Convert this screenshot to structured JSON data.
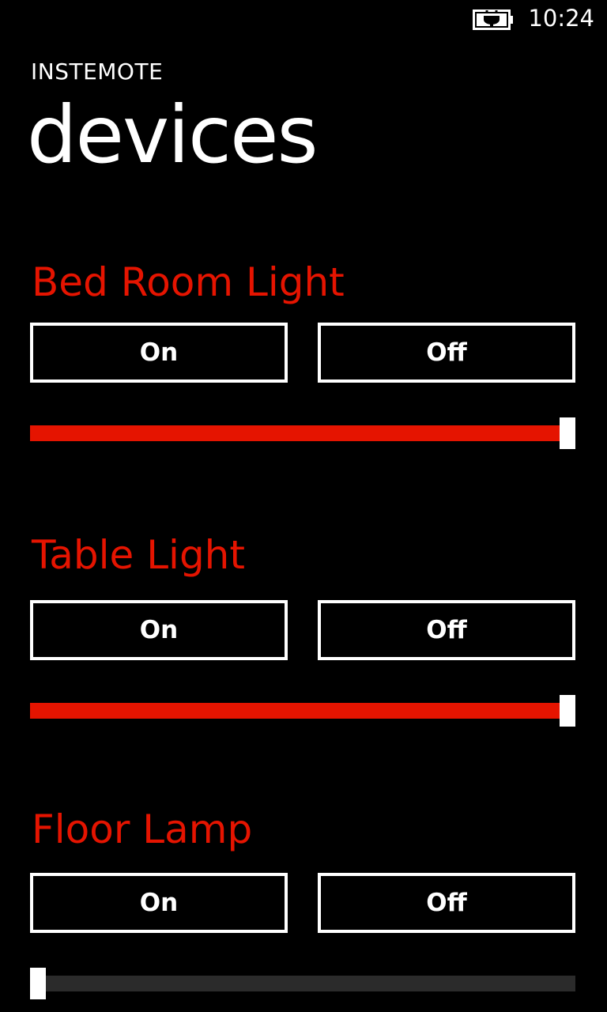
{
  "status_bar": {
    "time": "10:24",
    "battery_icon": "battery-charging-icon"
  },
  "app": {
    "title": "INSTEMOTE",
    "page_title": "devices"
  },
  "colors": {
    "accent": "#e51400",
    "background": "#000000",
    "foreground": "#ffffff",
    "track": "#2b2b2b"
  },
  "devices": [
    {
      "name": "Bed Room Light",
      "on_label": "On",
      "off_label": "Off",
      "level": 1.0
    },
    {
      "name": "Table Light",
      "on_label": "On",
      "off_label": "Off",
      "level": 1.0
    },
    {
      "name": "Floor Lamp",
      "on_label": "On",
      "off_label": "Off",
      "level": 0.0
    }
  ]
}
